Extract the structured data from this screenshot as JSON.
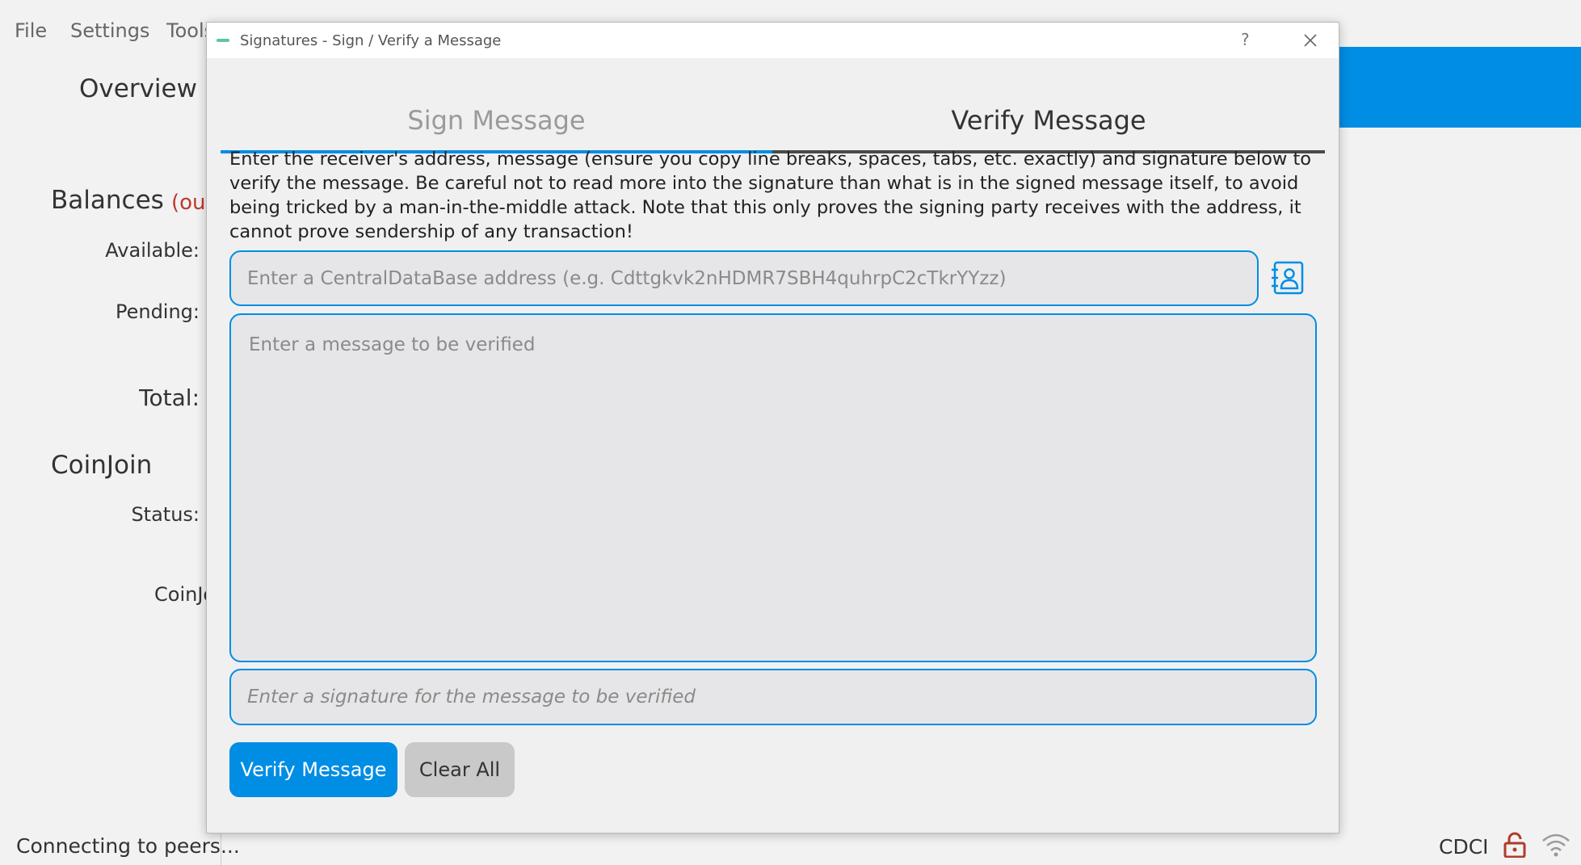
{
  "menu": [
    "File",
    "Settings",
    "Tools"
  ],
  "overview": {
    "nav_title": "Overview",
    "balances_title": "Balances",
    "out_of_sync": "(out",
    "available_label": "Available:",
    "pending_label": "Pending:",
    "total_label": "Total:",
    "coinjoin_title": "CoinJoin",
    "status_label": "Status:",
    "coinjoin_label": "CoinJo"
  },
  "statusbar": {
    "connection_text": "Connecting to peers...",
    "unit": "CDCI"
  },
  "dialog": {
    "title": "Signatures - Sign / Verify a Message",
    "help_label": "?",
    "tabs": [
      {
        "label": "Sign Message"
      },
      {
        "label": "Verify Message"
      }
    ],
    "instructions": "Enter the receiver's address, message (ensure you copy line breaks, spaces, tabs, etc. exactly) and signature below to verify the message. Be careful not to read more into the signature than what is in the signed message itself, to avoid being tricked by a man-in-the-middle attack. Note that this only proves the signing party receives with the address, it cannot prove sendership of any transaction!",
    "address_placeholder": "Enter a CentralDataBase address (e.g. Cdttgkvk2nHDMR7SBH4quhrpC2cTkrYYzz)",
    "message_placeholder": "Enter a message to be verified",
    "signature_placeholder": "Enter a signature for the message to be verified",
    "verify_button": "Verify Message",
    "clear_button": "Clear All"
  },
  "colors": {
    "accent": "#008de4",
    "warning": "#c0392b"
  },
  "icons": [
    "address-book-icon",
    "close-icon",
    "lock-icon",
    "network-icon"
  ]
}
